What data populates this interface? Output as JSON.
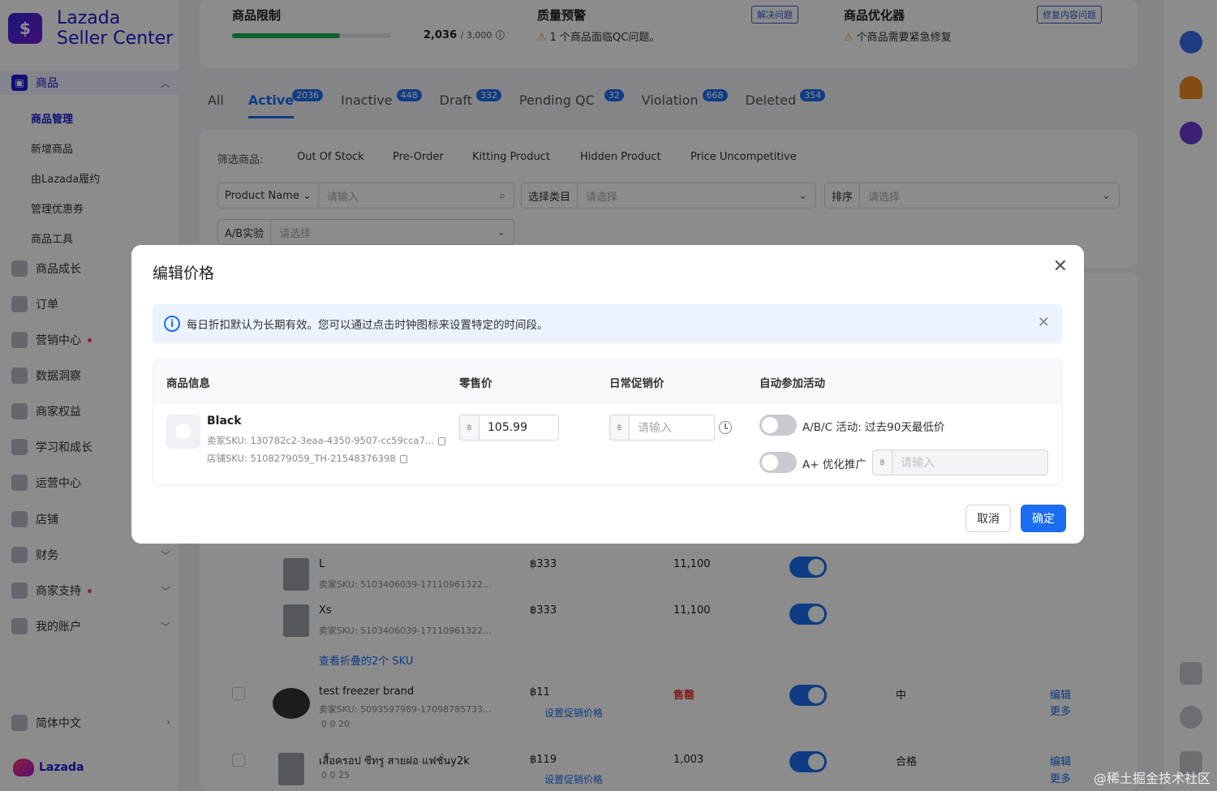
{
  "brand": {
    "line1": "Lazada",
    "line2": "Seller Center",
    "footer": "Lazada"
  },
  "sidebar": {
    "groups": [
      {
        "label": "商品",
        "active": true
      },
      {
        "label": "商品成长"
      },
      {
        "label": "订单"
      },
      {
        "label": "营销中心"
      },
      {
        "label": "数据洞察"
      },
      {
        "label": "商家权益"
      },
      {
        "label": "学习和成长"
      },
      {
        "label": "运营中心"
      },
      {
        "label": "店铺"
      },
      {
        "label": "财务"
      },
      {
        "label": "商家支持"
      },
      {
        "label": "我的账户"
      },
      {
        "label": "简体中文"
      }
    ],
    "sub_items": [
      {
        "label": "商品管理",
        "active": true
      },
      {
        "label": "新增商品"
      },
      {
        "label": "由Lazada履约"
      },
      {
        "label": "管理优惠券"
      },
      {
        "label": "商品工具"
      }
    ]
  },
  "kpis": {
    "limit": {
      "title": "商品限制",
      "value": "2,036",
      "max": "/ 3,000",
      "progress_pct": 68
    },
    "quality": {
      "title": "质量预警",
      "button": "解决问题",
      "warning": "1 个商品面临QC问题。"
    },
    "optimizer": {
      "title": "商品优化器",
      "button": "修复内容问题",
      "warning": "个商品需要紧急修复"
    }
  },
  "tabs": [
    {
      "label": "All"
    },
    {
      "label": "Active",
      "count": "2036",
      "active": true
    },
    {
      "label": "Inactive",
      "count": "448"
    },
    {
      "label": "Draft",
      "count": "332"
    },
    {
      "label": "Pending QC",
      "count": "32"
    },
    {
      "label": "Violation",
      "count": "668"
    },
    {
      "label": "Deleted",
      "count": "354"
    }
  ],
  "filters": {
    "label": "筛选商品:",
    "chips": [
      "Out Of Stock",
      "Pre-Order",
      "Kitting Product",
      "Hidden Product",
      "Price Uncompetitive"
    ],
    "search_prefix": "Product Name",
    "search_placeholder": "请输入",
    "category_prefix": "选择类目",
    "category_placeholder": "请选择",
    "sort_prefix": "排序",
    "sort_placeholder": "请选择",
    "ab_prefix": "A/B实验",
    "ab_placeholder": "请选择"
  },
  "bg_rows": [
    {
      "name": "L",
      "sku": "卖家SKU: 5103406039-17110961322...",
      "price": "฿333",
      "stock": "11,100"
    },
    {
      "name": "Xs",
      "sku": "卖家SKU: 5103406039-17110961322...",
      "price": "฿333",
      "stock": "11,100"
    },
    {
      "link": "查看折叠的2个 SKU"
    },
    {
      "name": "test freezer brand",
      "sku": "卖家SKU: 5093597989-17098785733...",
      "stats": "0   0   20",
      "price": "฿11",
      "promo_link": "设置促销价格",
      "stock": "售罄",
      "quality": "中",
      "edit": "编辑",
      "more": "更多"
    },
    {
      "name": "เสื้อครอป ซีทรู สายฝอ แฟชั่นy2k",
      "stats": "0   0   25",
      "price": "฿119",
      "promo_link": "设置促销价格",
      "stock": "1,003",
      "quality": "合格",
      "edit": "编辑",
      "more": "更多"
    }
  ],
  "modal": {
    "title": "编辑价格",
    "notice": "每日折扣默认为长期有效。您可以通过点击时钟图标来设置特定的时间段。",
    "columns": {
      "product": "商品信息",
      "retail": "零售价",
      "promo": "日常促销价",
      "auto": "自动参加活动"
    },
    "product": {
      "name": "Black",
      "seller_sku": "卖家SKU: 130782c2-3eaa-4350-9507-cc59cca7...",
      "shop_sku": "店铺SKU: 5108279059_TH-21548376398"
    },
    "retail_value": "105.99",
    "promo_placeholder": "请输入",
    "currency": "฿",
    "toggle1_label": "A/B/C 活动: 过去90天最低价",
    "toggle2_label": "A+ 优化推广",
    "toggle2_placeholder": "请输入",
    "cancel": "取消",
    "confirm": "确定"
  },
  "watermark": "@稀土掘金技术社区",
  "colors": {
    "primary": "#1a6df0",
    "brand": "#1a1ad6",
    "success": "#20b050",
    "warning": "#f0a020"
  }
}
